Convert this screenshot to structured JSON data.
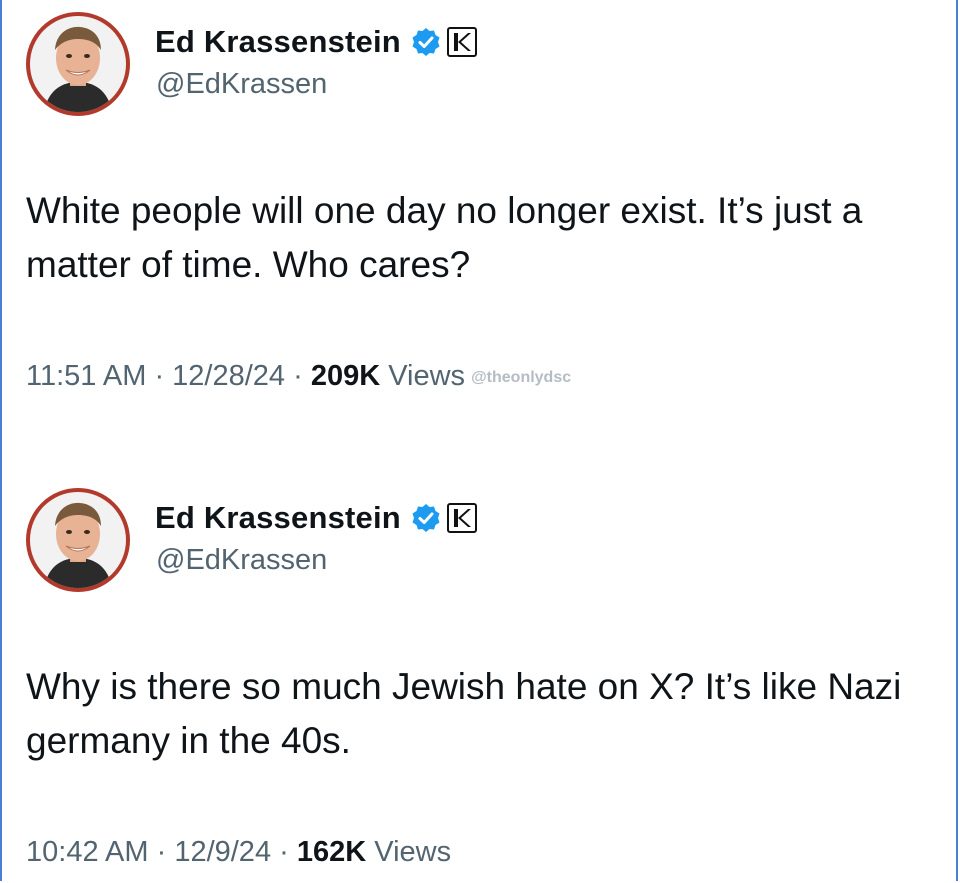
{
  "tweets": [
    {
      "author": {
        "name": "Ed Krassenstein",
        "handle": "@EdKrassen",
        "verified_icon": "verified-badge-icon",
        "affiliation_icon": "k-logo-icon",
        "accent": "#1d9bf0"
      },
      "text": "White people will one day no longer exist. It’s just a matter of time. Who cares?",
      "time": "11:51 AM",
      "sep1": " · ",
      "date": "12/28/24",
      "sep2": " · ",
      "views_count": "209K",
      "views_label": " Views",
      "watermark": "@theonlydsc"
    },
    {
      "author": {
        "name": "Ed Krassenstein",
        "handle": "@EdKrassen",
        "verified_icon": "verified-badge-icon",
        "affiliation_icon": "k-logo-icon",
        "accent": "#1d9bf0"
      },
      "text": "Why is there so much Jewish hate on X?  It’s like Nazi germany in the 40s.",
      "time": "10:42 AM",
      "sep1": " · ",
      "date": "12/9/24",
      "sep2": " · ",
      "views_count": "162K",
      "views_label": " Views"
    }
  ]
}
